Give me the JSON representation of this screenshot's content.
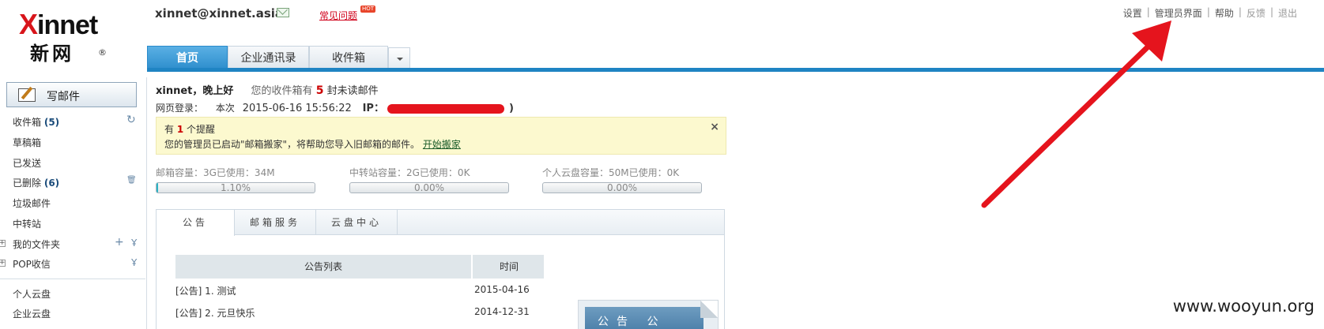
{
  "header": {
    "logo_brand_first": "X",
    "logo_brand_rest": "innet",
    "logo_cn": "新网",
    "logo_reg": "®",
    "user_email": "xinnet@xinnet.asia",
    "faq_label": "常见问题",
    "hot_badge": "HOT",
    "top_links": {
      "settings": "设置",
      "admin": "管理员界面",
      "help": "帮助",
      "feedback": "反馈",
      "logout": "退出",
      "separator": "|"
    }
  },
  "tabs": {
    "home": "首页",
    "contacts": "企业通讯录",
    "inbox": "收件箱"
  },
  "sidebar": {
    "compose": "写邮件",
    "folders": {
      "inbox": "收件箱",
      "inbox_count": "(5)",
      "drafts": "草稿箱",
      "sent": "已发送",
      "deleted": "已删除",
      "deleted_count": "(6)",
      "spam": "垃圾邮件",
      "transfer": "中转站",
      "my_folders": "我的文件夹",
      "pop": "POP收信",
      "personal_cloud": "个人云盘",
      "enterprise_cloud": "企业云盘"
    },
    "icons": {
      "refresh": "↻",
      "trash": "🗑",
      "add": "+",
      "filter": "Ұ",
      "expand": "+"
    }
  },
  "greeting": {
    "name": "xinnet，晚上好",
    "unread_prefix": "您的收件箱有",
    "unread_count": "5",
    "unread_suffix": "封未读邮件"
  },
  "login": {
    "label": "网页登录：",
    "current": "本次",
    "timestamp": "2015-06-16 15:56:22",
    "ip_label": "IP：",
    "ip_close": ")"
  },
  "notice": {
    "title_prefix": "有",
    "count": "1",
    "title_suffix": "个提醒",
    "body": "您的管理员已启动\"邮箱搬家\"，将帮助您导入旧邮箱的邮件。",
    "link": "开始搬家",
    "close": "×"
  },
  "quotas": [
    {
      "label": "邮箱容量：3G已使用：34M",
      "percent_text": "1.10%",
      "fraction": 0.011
    },
    {
      "label": "中转站容量：2G已使用：0K",
      "percent_text": "0.00%",
      "fraction": 0
    },
    {
      "label": "个人云盘容量：50M已使用：0K",
      "percent_text": "0.00%",
      "fraction": 0
    }
  ],
  "panel": {
    "tabs": [
      "公告",
      "邮箱服务",
      "云盘中心"
    ],
    "table_header": {
      "title": "公告列表",
      "time": "时间"
    },
    "rows": [
      {
        "title": "[公告] 1. 测试",
        "date": "2015-04-16"
      },
      {
        "title": "[公告] 2. 元旦快乐",
        "date": "2014-12-31"
      }
    ],
    "thumb_text": "公告 公"
  },
  "watermark": "www.wooyun.org",
  "colors": {
    "accent_blue": "#1f84c3",
    "arrow_red": "#e5141d",
    "notice_bg": "#fcf9cf"
  }
}
